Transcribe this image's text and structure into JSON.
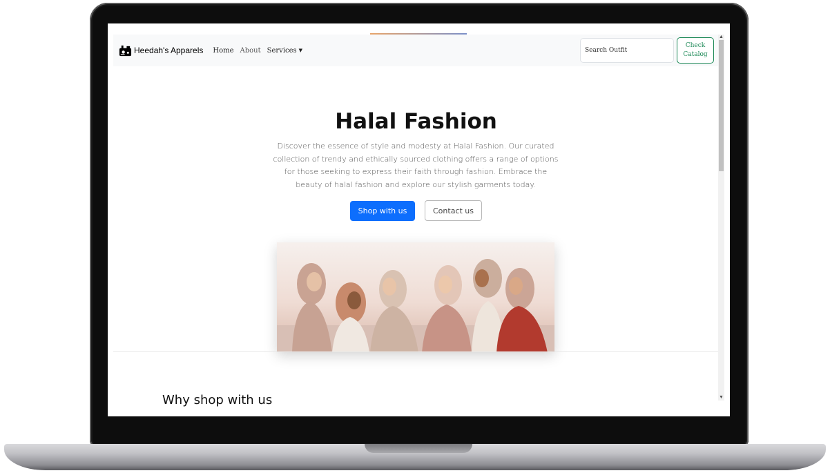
{
  "navbar": {
    "brand": "Heedah's Apparels",
    "links": [
      {
        "label": "Home"
      },
      {
        "label": "About"
      },
      {
        "label": "Services"
      }
    ],
    "search_placeholder": "Search Outfit",
    "catalog_button": "Check Catalog"
  },
  "hero": {
    "title": "Halal Fashion",
    "description": "Discover the essence of style and modesty at Halal Fashion. Our curated collection of trendy and ethically sourced clothing offers a range of options for those seeking to express their faith through fashion. Embrace the beauty of halal fashion and explore our stylish garments today.",
    "primary_button": "Shop with us",
    "secondary_button": "Contact us"
  },
  "section": {
    "title": "Why shop with us"
  },
  "colors": {
    "primary": "#0d6efd",
    "success": "#198754",
    "navbar_bg": "#f8f9fa"
  },
  "icons": {
    "brand": "sewing-machine-icon",
    "services_caret": "caret-down-icon"
  }
}
